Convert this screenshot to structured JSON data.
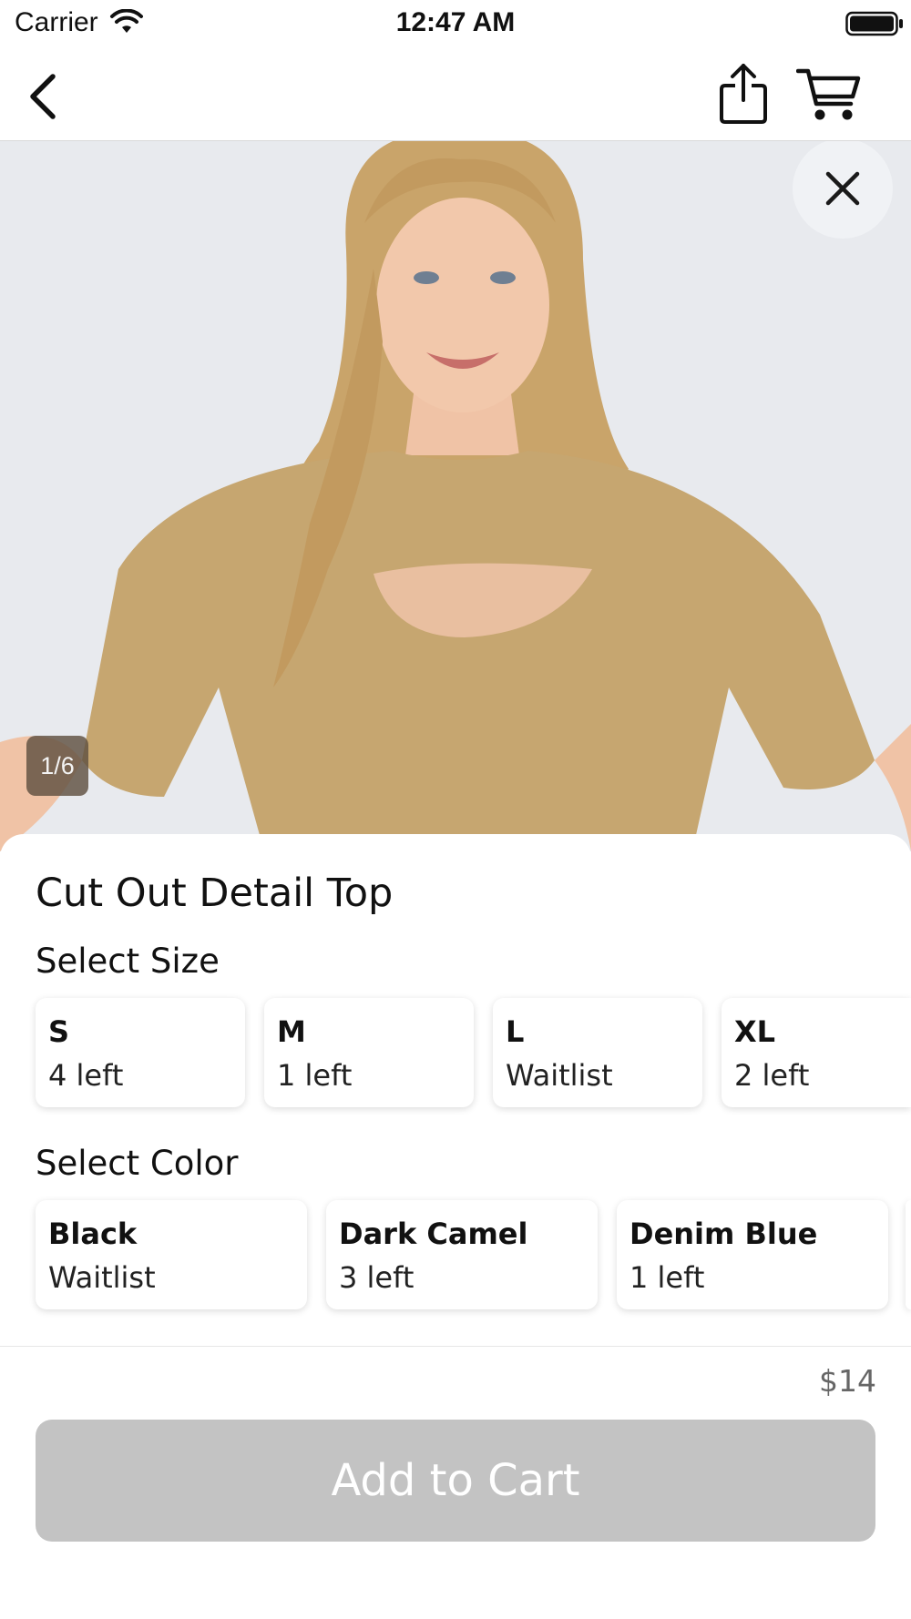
{
  "status_bar": {
    "carrier": "Carrier",
    "time": "12:47 AM",
    "icons": [
      "wifi-icon",
      "battery-icon"
    ]
  },
  "nav_bar": {
    "icons": [
      "back-chevron-icon",
      "share-icon",
      "cart-icon"
    ]
  },
  "product_image": {
    "counter": "1/6",
    "close_icon": "close-icon",
    "colors": {
      "background": "#e8eaee",
      "shirt": "#c6a670",
      "hair": "#c9a46a"
    }
  },
  "product": {
    "title": "Cut Out Detail Top",
    "price": "$14"
  },
  "size_section": {
    "label": "Select Size",
    "options": [
      {
        "name": "S",
        "stock": "4 left"
      },
      {
        "name": "M",
        "stock": "1 left"
      },
      {
        "name": "L",
        "stock": "Waitlist"
      },
      {
        "name": "XL",
        "stock": "2 left"
      }
    ]
  },
  "color_section": {
    "label": "Select Color",
    "options": [
      {
        "name": "Black",
        "stock": "Waitlist"
      },
      {
        "name": "Dark Camel",
        "stock": "3 left"
      },
      {
        "name": "Denim Blue",
        "stock": "1 left"
      }
    ]
  },
  "actions": {
    "add_to_cart_label": "Add to Cart",
    "add_to_cart_color": "#c3c3c3"
  }
}
